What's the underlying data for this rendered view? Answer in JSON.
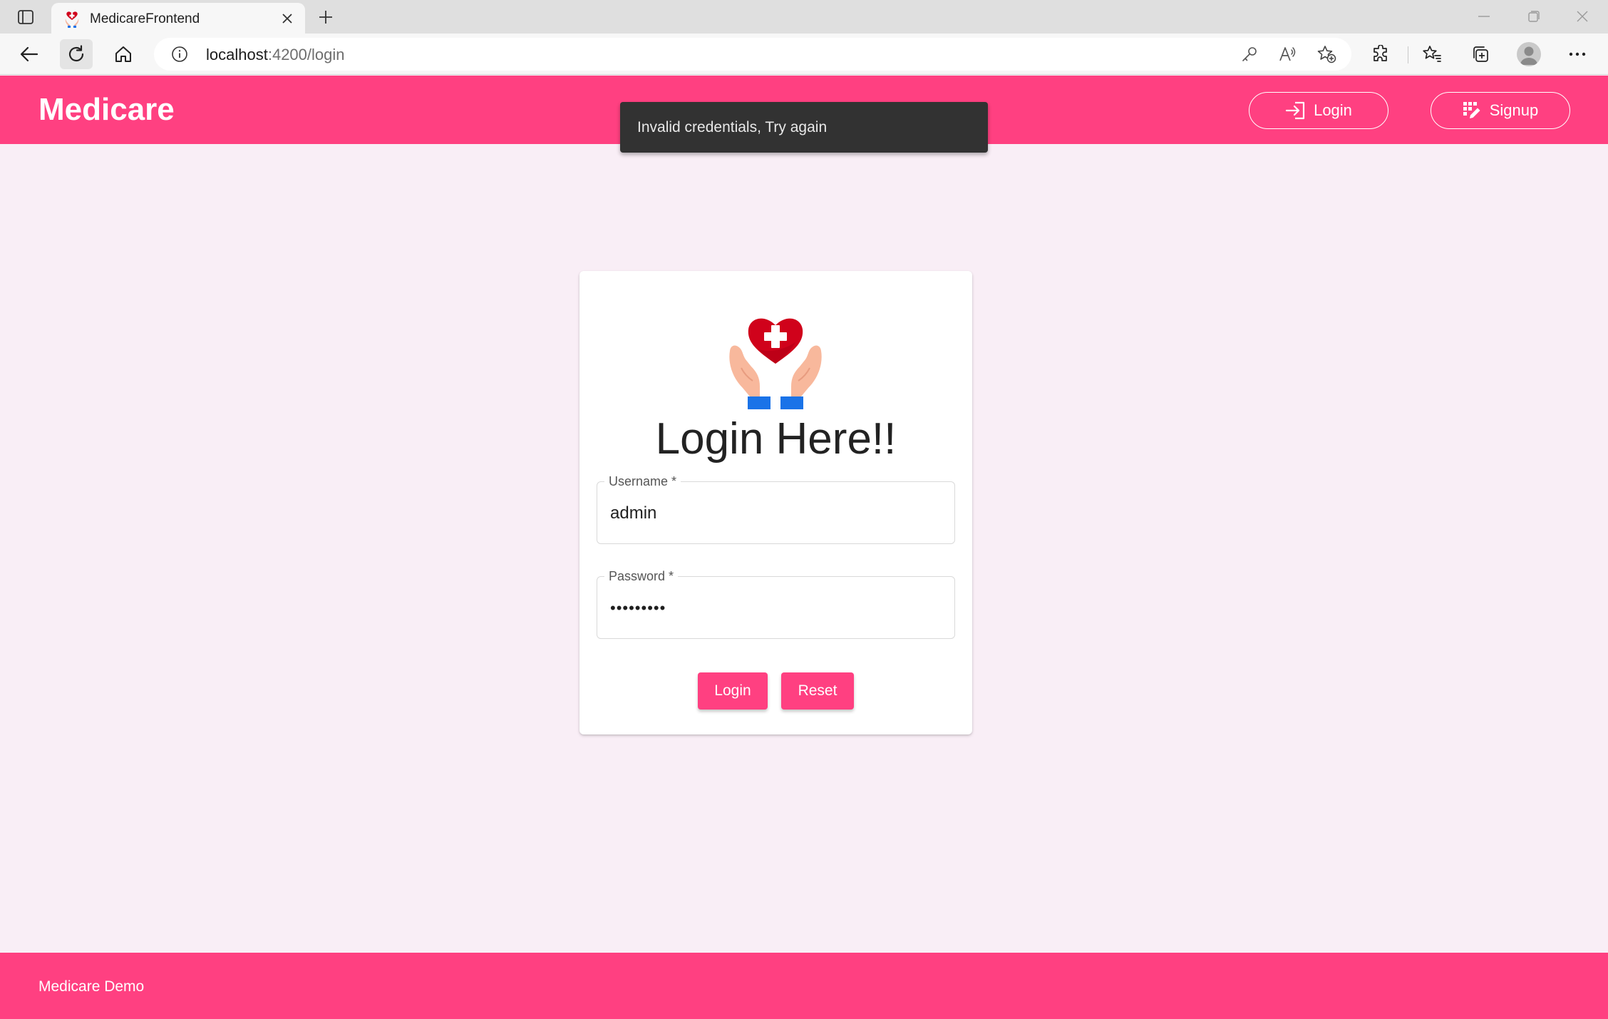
{
  "browser": {
    "tab_title": "MedicareFrontend",
    "url_host": "localhost",
    "url_path": ":4200/login"
  },
  "header": {
    "brand": "Medicare",
    "login_label": "Login",
    "signup_label": "Signup"
  },
  "snackbar": {
    "message": "Invalid credentials, Try again"
  },
  "login_card": {
    "title": "Login Here!!",
    "username_label": "Username *",
    "username_value": "admin",
    "password_label": "Password *",
    "password_value": "password1",
    "login_button": "Login",
    "reset_button": "Reset"
  },
  "footer": {
    "text": "Medicare Demo"
  },
  "colors": {
    "primary": "#ff4081",
    "page_background": "#f9eef6",
    "snackbar": "#323232"
  }
}
